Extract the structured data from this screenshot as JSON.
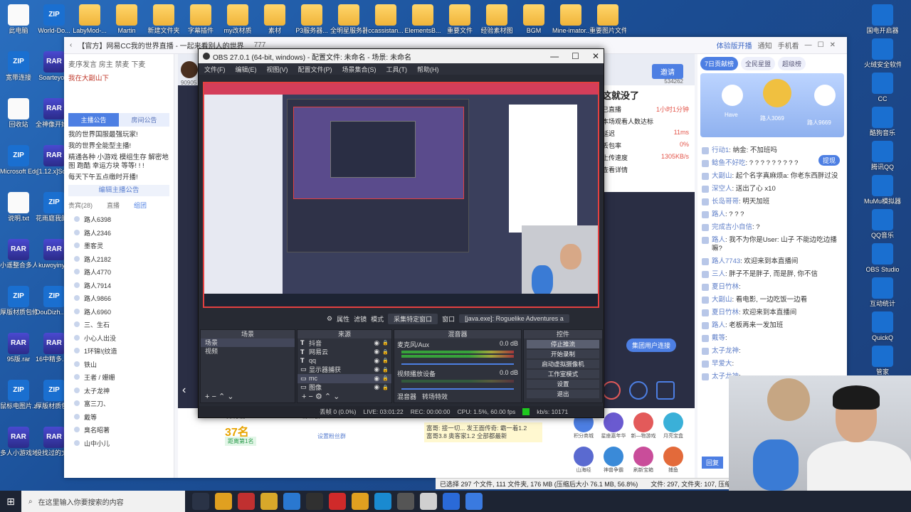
{
  "desktop": {
    "left_icons": [
      {
        "label": "此电脑",
        "type": "file"
      },
      {
        "label": "World-Do...",
        "type": "zip"
      },
      {
        "label": "宽带连接",
        "type": "zip"
      },
      {
        "label": "Soarteyo...",
        "type": "rar"
      },
      {
        "label": "回收站",
        "type": "file"
      },
      {
        "label": "全神像开始...",
        "type": "rar"
      },
      {
        "label": "Microsoft Edge",
        "type": "zip"
      },
      {
        "label": "[1.12.x]So...",
        "type": "rar"
      },
      {
        "label": "说明.txt",
        "type": "file"
      },
      {
        "label": "花雨庭我的床材质包",
        "type": "zip"
      },
      {
        "label": "小遥整合多人小游戏地图...",
        "type": "rar"
      },
      {
        "label": "kuwoyiny...",
        "type": "rar"
      },
      {
        "label": "厚版材质包修改+uhc粮...",
        "type": "zip"
      },
      {
        "label": "DouDizh... Resource...",
        "type": "zip"
      },
      {
        "label": "95版.rar",
        "type": "rar"
      },
      {
        "label": "16中精多...取暖框隐...",
        "type": "rar"
      },
      {
        "label": "鼠标电图片.zip",
        "type": "zip"
      },
      {
        "label": "厚版材质包修改+uhc粮...",
        "type": "zip"
      },
      {
        "label": "多人小游戏地图集.rar",
        "type": "rar"
      },
      {
        "label": "没找过的文件.rar",
        "type": "rar"
      }
    ],
    "top_icons": [
      "LabyMod-...",
      "Martin",
      "新建文件夹",
      "字幕插件",
      "my改材质",
      "素材",
      "P3服务器...",
      "全明星服务器...",
      "ccassistan...",
      "ElementsB...",
      "重要文件",
      "经验素材图",
      "BGM",
      "Mine-imator...",
      "重要图片文件"
    ],
    "right_icons": [
      "国电开启器",
      "火绒安全软件",
      "CC",
      "酷狗音乐",
      "腾讯QQ",
      "MuMu模拟器",
      "QQ音乐",
      "OBS Studio",
      "互动统计",
      "QuickQ",
      "管家"
    ]
  },
  "live": {
    "window_title": "【官方】网易CC我的世界直播 - 一起来看别人的世界",
    "viewer_count_top": "777",
    "experience_label": "体验版开播",
    "notify_label": "通知",
    "phone_label": "手机看",
    "left_panel": {
      "header": "麦序发言  房主  禁麦  下麦",
      "self_item": "我在大副山下",
      "tabs": [
        "主播公告",
        "房间公告"
      ],
      "announcement": [
        "我的世界国服最强玩家!",
        "我的世界全能型主播!",
        "精通各种 小游戏 模组生存 解密地图 跑酷 幸运方块 等等! ! !",
        "每天下午五点缴时开播!"
      ],
      "edit_label": "编辑主播公告",
      "viewer_tabs": [
        "贵宾(28)",
        "直播",
        "组团"
      ],
      "viewers": [
        "路人6398",
        "路人2346",
        "墨客灵",
        "路人2182",
        "路人4770",
        "路人7914",
        "路人9866",
        "路人6960",
        "三、生石",
        "小心人出没",
        "1环锦!(纹造",
        "铁山",
        "王者 / 姗姗",
        "太子龙神",
        "富三刀、",
        "戴等",
        "臭名昭著",
        "山中小儿"
      ]
    },
    "center": {
      "room_id": "90905",
      "invite_label": "邀请",
      "invite_count": "534262",
      "stats_title": "这就没了",
      "stats": [
        {
          "label": "已直播",
          "value": "1小时1分钟"
        },
        {
          "label": "本场观看人数达标",
          "value": ""
        },
        {
          "label": "延迟",
          "value": "11ms"
        },
        {
          "label": "丢包率",
          "value": "0%"
        },
        {
          "label": "上传速度",
          "value": "1305KB/s"
        },
        {
          "label": "查看详情",
          "value": ""
        }
      ],
      "set_label": "集团用户连接"
    },
    "bottom": {
      "rank_label": "排行榜",
      "fans_label": "粉丝群",
      "rank_count": "37名",
      "rank_sub": "距离第1名",
      "fans_link": "设置粉丝群",
      "ticker": [
        "富哥: 接一切...  发王面传奇: 霸一着1.2",
        "富哥3.8 奥客家1.2 全部都最新"
      ],
      "gifts": [
        "积分商城",
        "星座嘉年华",
        "新—物游戏",
        "月亮宝盒",
        "山海经",
        "神兽争霸",
        "刷新宝箱",
        "捕鱼"
      ]
    },
    "right_panel": {
      "rank_tabs": [
        "7日贡献榜",
        "全民星盟",
        "超级榜"
      ],
      "top_fans": [
        {
          "name": "Have",
          "count": ""
        },
        {
          "name": "路人3069",
          "count": ""
        },
        {
          "name": "路人9669",
          "count": ""
        }
      ],
      "chat": [
        {
          "name": "行动1",
          "text": "纳金: 不加班吗"
        },
        {
          "name": "鲶鱼不好吃",
          "text": "? ? ? ? ? ? ? ? ?"
        },
        {
          "name": "大副山",
          "text": "起个名字真麻烦a: 你老东西胖过没"
        },
        {
          "name": "深空人",
          "text": "送出了心 x10"
        },
        {
          "name": "长岛哥哥",
          "text": "明天加班"
        },
        {
          "name": "路人",
          "text": "? ? ?"
        },
        {
          "name": "完成吉小自信",
          "text": "?"
        },
        {
          "name": "路人",
          "text": "我不为你是User: 山子 不能边吃边播嘛?"
        },
        {
          "name": "路人7743",
          "text": "欢迎来到本直播间"
        },
        {
          "name": "三人",
          "text": "胖子不是胖子, 而是胖, 你不信"
        },
        {
          "name": "夏日竹林",
          "text": ""
        },
        {
          "name": "大副山",
          "text": "看电影, 一边吃饭一边看"
        },
        {
          "name": "夏日竹林",
          "text": "欢迎来到本直播间"
        },
        {
          "name": "路人",
          "text": "老板再来一发加班"
        },
        {
          "name": "戴等",
          "text": ""
        },
        {
          "name": "太子龙神",
          "text": ""
        },
        {
          "name": "早爱大",
          "text": ""
        },
        {
          "name": "太子龙神",
          "text": ""
        }
      ],
      "reply_label": "提现",
      "send_label": "回复"
    }
  },
  "obs": {
    "title": "OBS 27.0.1 (64-bit, windows) - 配置文件: 未命名 - 场景: 未命名",
    "menu": [
      "文件(F)",
      "编辑(E)",
      "视图(V)",
      "配置文件(P)",
      "场景集合(S)",
      "工具(T)",
      "帮助(H)"
    ],
    "toolbar": {
      "props": "属性",
      "filters": "滤镜",
      "mode_label": "模式",
      "mode_value": "采集特定窗口",
      "window_label": "窗口",
      "window_value": "[java.exe]: Roguelike Adventures a"
    },
    "docks": {
      "scenes": {
        "title": "场景",
        "items": [
          "场景",
          "视频"
        ]
      },
      "sources": {
        "title": "来源",
        "items": [
          "抖音",
          "网易云",
          "qq",
          "显示器捕获",
          "mc",
          "图像"
        ]
      },
      "mixer": {
        "title": "混音器",
        "channels": [
          {
            "name": "麦克风/Aux",
            "db": "0.0 dB"
          },
          {
            "name": "视频播放设备",
            "db": "0.0 dB"
          }
        ],
        "tabs": [
          "混音器",
          "转场特效"
        ]
      },
      "controls": {
        "title": "控件",
        "buttons": [
          "停止推流",
          "开始录制",
          "启动虚拟摄像机",
          "工作室模式",
          "设置",
          "退出"
        ]
      }
    },
    "status": {
      "dropped": "丢帧 0 (0.0%)",
      "live": "LIVE: 03:01:22",
      "rec": "REC: 00:00:00",
      "cpu": "CPU: 1.5%, 60.00 fps",
      "kbps": "kb/s: 10171"
    }
  },
  "explorer": {
    "selected": "已选择 297 个文件, 111 文件夹, 176 MB (压缩后大小 76.1 MB, 56.8%)",
    "totals": "文件: 297, 文件夹: 107, 压缩包大小..."
  },
  "taskbar": {
    "search_placeholder": "在这里输入你要搜索的内容",
    "apps": [
      "task-view",
      "chrome",
      "netease",
      "explorer",
      "edge",
      "obs",
      "netease-music",
      "cc-live",
      "qq",
      "photos",
      "sogou",
      "bilibili",
      "cc"
    ]
  },
  "colors": {
    "accent": "#4d7fe3",
    "obs_preview_border": "#e34040",
    "live_green": "#1ec81e",
    "desktop_blue": "#1e5aa8"
  }
}
